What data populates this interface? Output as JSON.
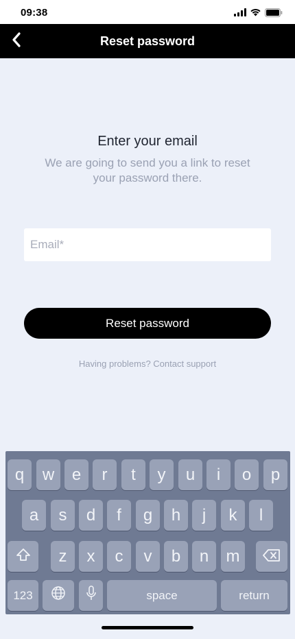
{
  "status_bar": {
    "time": "09:38"
  },
  "nav": {
    "title": "Reset password",
    "back_icon": "chevron-left-icon"
  },
  "main": {
    "heading": "Enter your email",
    "subtext": "We are going to send you a link to reset your password there.",
    "email_placeholder": "Email*",
    "email_value": "",
    "submit_label": "Reset password",
    "support_text": "Having problems? Contact support"
  },
  "keyboard": {
    "row1": [
      "q",
      "w",
      "e",
      "r",
      "t",
      "y",
      "u",
      "i",
      "o",
      "p"
    ],
    "row2": [
      "a",
      "s",
      "d",
      "f",
      "g",
      "h",
      "j",
      "k",
      "l"
    ],
    "row3": [
      "z",
      "x",
      "c",
      "v",
      "b",
      "n",
      "m"
    ],
    "numbers_label": "123",
    "space_label": "space",
    "return_label": "return"
  },
  "colors": {
    "nav_background": "#000000",
    "page_background": "#ecf0f9",
    "button_background": "#000000",
    "keyboard_background": "#6f7a93",
    "key_background": "#99a2b7"
  }
}
